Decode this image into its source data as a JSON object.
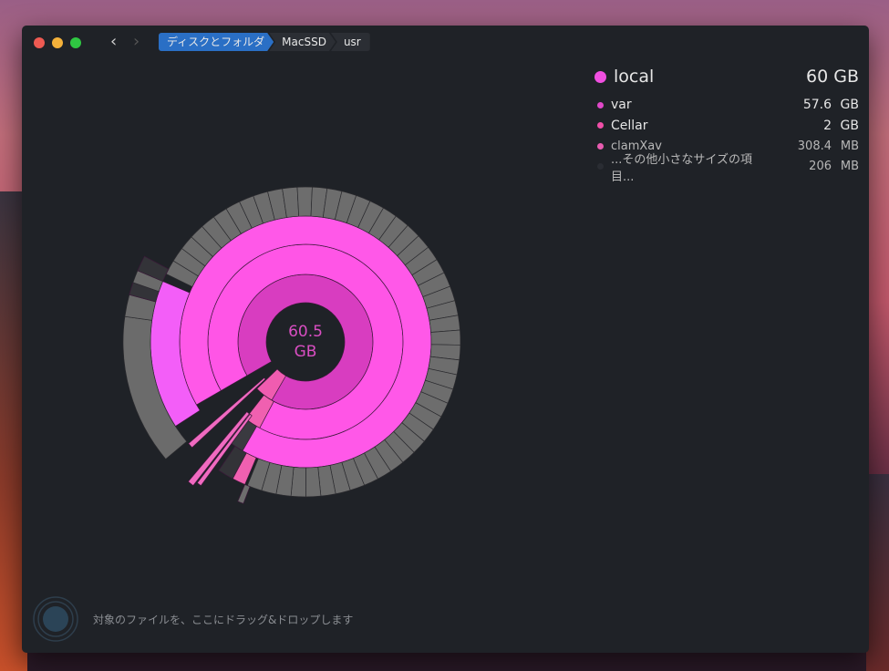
{
  "toolbar": {
    "back_icon": "chevron-left-icon",
    "forward_icon": "chevron-right-icon",
    "breadcrumbs": [
      "ディスクとフォルダ",
      "MacSSD",
      "usr"
    ]
  },
  "legend": {
    "root": {
      "name": "local",
      "size": "60 GB",
      "color": "#f04fe0"
    },
    "items": [
      {
        "name": "var",
        "num": "57.6",
        "unit": "GB",
        "color": "#e048c8"
      },
      {
        "name": "Cellar",
        "num": "2",
        "unit": "GB",
        "color": "#f04fa8"
      },
      {
        "name": "clamXav",
        "num": "308.4",
        "unit": "MB",
        "color": "#e85cb0"
      },
      {
        "name": "...その他小さなサイズの項目...",
        "num": "206",
        "unit": "MB",
        "color": "#2a2d33"
      }
    ]
  },
  "chart_data": {
    "type": "sunburst",
    "center_label": [
      "60.5",
      "GB"
    ],
    "root": "local",
    "children": [
      {
        "name": "var",
        "value_gb": 57.6
      },
      {
        "name": "Cellar",
        "value_gb": 2
      },
      {
        "name": "clamXav",
        "value_gb": 0.3084
      },
      {
        "name": "other small items",
        "value_gb": 0.206
      }
    ]
  },
  "footer": {
    "drop_hint": "対象のファイルを、ここにドラッグ&ドロップします"
  }
}
